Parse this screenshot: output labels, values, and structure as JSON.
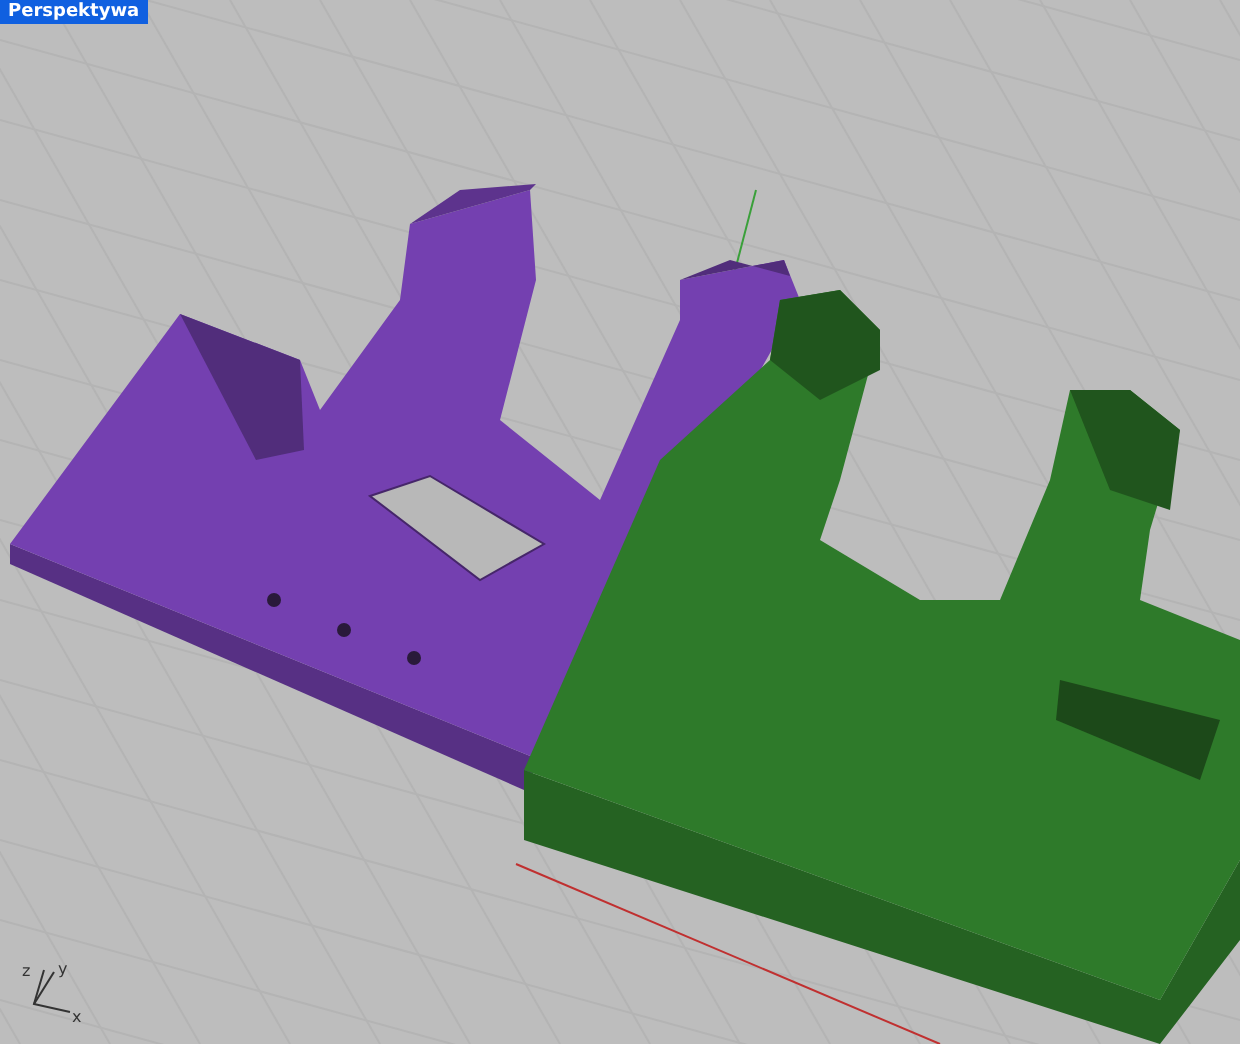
{
  "viewport": {
    "title": "Perspektywa"
  },
  "models": [
    {
      "color": "#7440b0"
    },
    {
      "color": "#2e7a2a"
    }
  ],
  "axis_widget": {
    "x_label": "x",
    "y_label": "y",
    "z_label": "z"
  }
}
